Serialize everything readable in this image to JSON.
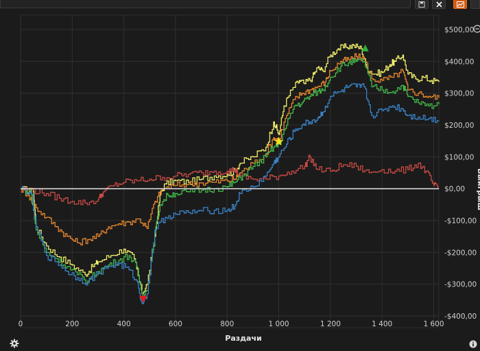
{
  "chart_data": {
    "type": "line",
    "title": "",
    "xlabel": "Раздачи",
    "ylabel": "Выигрыш",
    "xlim": [
      0,
      1620
    ],
    "ylim": [
      -400,
      500
    ],
    "x_ticks": [
      0,
      200,
      400,
      600,
      800,
      1000,
      1200,
      1400,
      1600
    ],
    "x_tick_labels": [
      "0",
      "200",
      "400",
      "600",
      "800",
      "1 000",
      "1 200",
      "1 400",
      "1 600"
    ],
    "y_ticks": [
      500,
      400,
      300,
      200,
      100,
      0,
      -100,
      -200,
      -300,
      -400
    ],
    "y_tick_labels": [
      "$500,00",
      "$400,00",
      "$300,00",
      "$200,00",
      "$100,00",
      "$0,00",
      "-$100,00",
      "-$200,00",
      "-$300,00",
      "-$400,00"
    ],
    "grid": true,
    "series": [
      {
        "color": "#f2ef6a",
        "points": [
          [
            0,
            0
          ],
          [
            50,
            -10
          ],
          [
            60,
            -120
          ],
          [
            100,
            -180
          ],
          [
            150,
            -215
          ],
          [
            200,
            -240
          ],
          [
            250,
            -270
          ],
          [
            280,
            -245
          ],
          [
            300,
            -230
          ],
          [
            350,
            -210
          ],
          [
            400,
            -190
          ],
          [
            440,
            -220
          ],
          [
            470,
            -330
          ],
          [
            490,
            -300
          ],
          [
            520,
            -150
          ],
          [
            540,
            -20
          ],
          [
            560,
            15
          ],
          [
            600,
            25
          ],
          [
            650,
            20
          ],
          [
            700,
            30
          ],
          [
            750,
            40
          ],
          [
            800,
            45
          ],
          [
            830,
            55
          ],
          [
            850,
            80
          ],
          [
            900,
            100
          ],
          [
            950,
            130
          ],
          [
            980,
            210
          ],
          [
            1000,
            170
          ],
          [
            1020,
            260
          ],
          [
            1050,
            310
          ],
          [
            1080,
            340
          ],
          [
            1100,
            330
          ],
          [
            1130,
            350
          ],
          [
            1150,
            380
          ],
          [
            1170,
            370
          ],
          [
            1200,
            420
          ],
          [
            1230,
            440
          ],
          [
            1260,
            445
          ],
          [
            1290,
            450
          ],
          [
            1320,
            440
          ],
          [
            1340,
            380
          ],
          [
            1370,
            360
          ],
          [
            1400,
            365
          ],
          [
            1430,
            390
          ],
          [
            1450,
            400
          ],
          [
            1480,
            420
          ],
          [
            1500,
            360
          ],
          [
            1530,
            345
          ],
          [
            1560,
            350
          ],
          [
            1590,
            340
          ],
          [
            1620,
            335
          ]
        ]
      },
      {
        "color": "#e7872e",
        "points": [
          [
            0,
            0
          ],
          [
            30,
            -20
          ],
          [
            60,
            -60
          ],
          [
            100,
            -90
          ],
          [
            140,
            -120
          ],
          [
            180,
            -150
          ],
          [
            220,
            -170
          ],
          [
            260,
            -160
          ],
          [
            300,
            -150
          ],
          [
            340,
            -120
          ],
          [
            380,
            -110
          ],
          [
            420,
            -105
          ],
          [
            460,
            -95
          ],
          [
            490,
            -125
          ],
          [
            520,
            -40
          ],
          [
            550,
            0
          ],
          [
            600,
            10
          ],
          [
            650,
            15
          ],
          [
            700,
            18
          ],
          [
            750,
            20
          ],
          [
            800,
            25
          ],
          [
            830,
            30
          ],
          [
            850,
            50
          ],
          [
            900,
            80
          ],
          [
            950,
            110
          ],
          [
            980,
            160
          ],
          [
            1000,
            155
          ],
          [
            1030,
            230
          ],
          [
            1060,
            280
          ],
          [
            1090,
            300
          ],
          [
            1120,
            310
          ],
          [
            1150,
            320
          ],
          [
            1180,
            335
          ],
          [
            1200,
            370
          ],
          [
            1240,
            400
          ],
          [
            1270,
            405
          ],
          [
            1300,
            415
          ],
          [
            1330,
            410
          ],
          [
            1360,
            345
          ],
          [
            1400,
            340
          ],
          [
            1440,
            350
          ],
          [
            1480,
            370
          ],
          [
            1500,
            310
          ],
          [
            1540,
            300
          ],
          [
            1580,
            290
          ],
          [
            1620,
            285
          ]
        ]
      },
      {
        "color": "#c94b45",
        "points": [
          [
            0,
            0
          ],
          [
            50,
            -5
          ],
          [
            100,
            -15
          ],
          [
            150,
            -30
          ],
          [
            200,
            -40
          ],
          [
            250,
            -45
          ],
          [
            300,
            -35
          ],
          [
            320,
            -10
          ],
          [
            360,
            10
          ],
          [
            400,
            20
          ],
          [
            450,
            25
          ],
          [
            500,
            30
          ],
          [
            550,
            35
          ],
          [
            600,
            40
          ],
          [
            650,
            45
          ],
          [
            700,
            50
          ],
          [
            750,
            55
          ],
          [
            800,
            55
          ],
          [
            830,
            60
          ],
          [
            850,
            40
          ],
          [
            900,
            30
          ],
          [
            950,
            30
          ],
          [
            1000,
            40
          ],
          [
            1050,
            55
          ],
          [
            1100,
            70
          ],
          [
            1120,
            100
          ],
          [
            1150,
            60
          ],
          [
            1200,
            55
          ],
          [
            1250,
            75
          ],
          [
            1300,
            70
          ],
          [
            1350,
            50
          ],
          [
            1400,
            60
          ],
          [
            1450,
            55
          ],
          [
            1500,
            60
          ],
          [
            1540,
            80
          ],
          [
            1570,
            55
          ],
          [
            1600,
            10
          ],
          [
            1620,
            0
          ]
        ]
      },
      {
        "color": "#44b94b",
        "points": [
          [
            0,
            0
          ],
          [
            40,
            -15
          ],
          [
            60,
            -130
          ],
          [
            100,
            -200
          ],
          [
            140,
            -220
          ],
          [
            180,
            -245
          ],
          [
            220,
            -270
          ],
          [
            260,
            -290
          ],
          [
            300,
            -260
          ],
          [
            340,
            -240
          ],
          [
            380,
            -225
          ],
          [
            420,
            -210
          ],
          [
            450,
            -245
          ],
          [
            470,
            -330
          ],
          [
            490,
            -320
          ],
          [
            520,
            -140
          ],
          [
            540,
            -50
          ],
          [
            570,
            -20
          ],
          [
            600,
            -15
          ],
          [
            650,
            -10
          ],
          [
            700,
            -5
          ],
          [
            750,
            0
          ],
          [
            800,
            5
          ],
          [
            830,
            20
          ],
          [
            860,
            40
          ],
          [
            900,
            70
          ],
          [
            950,
            100
          ],
          [
            980,
            130
          ],
          [
            1000,
            140
          ],
          [
            1030,
            200
          ],
          [
            1060,
            260
          ],
          [
            1090,
            270
          ],
          [
            1120,
            290
          ],
          [
            1150,
            305
          ],
          [
            1170,
            310
          ],
          [
            1200,
            350
          ],
          [
            1240,
            385
          ],
          [
            1270,
            395
          ],
          [
            1300,
            400
          ],
          [
            1330,
            400
          ],
          [
            1360,
            320
          ],
          [
            1400,
            310
          ],
          [
            1440,
            305
          ],
          [
            1480,
            325
          ],
          [
            1500,
            290
          ],
          [
            1540,
            270
          ],
          [
            1580,
            260
          ],
          [
            1620,
            265
          ]
        ]
      },
      {
        "color": "#3a84c9",
        "points": [
          [
            0,
            0
          ],
          [
            40,
            -10
          ],
          [
            60,
            -120
          ],
          [
            100,
            -210
          ],
          [
            140,
            -230
          ],
          [
            180,
            -260
          ],
          [
            220,
            -280
          ],
          [
            260,
            -295
          ],
          [
            300,
            -265
          ],
          [
            340,
            -245
          ],
          [
            380,
            -235
          ],
          [
            420,
            -255
          ],
          [
            450,
            -290
          ],
          [
            470,
            -360
          ],
          [
            490,
            -330
          ],
          [
            520,
            -130
          ],
          [
            560,
            -90
          ],
          [
            600,
            -80
          ],
          [
            650,
            -75
          ],
          [
            700,
            -70
          ],
          [
            750,
            -68
          ],
          [
            800,
            -68
          ],
          [
            830,
            -55
          ],
          [
            850,
            -15
          ],
          [
            900,
            5
          ],
          [
            950,
            40
          ],
          [
            980,
            80
          ],
          [
            1000,
            100
          ],
          [
            1030,
            140
          ],
          [
            1060,
            180
          ],
          [
            1090,
            200
          ],
          [
            1120,
            210
          ],
          [
            1150,
            220
          ],
          [
            1170,
            240
          ],
          [
            1200,
            290
          ],
          [
            1240,
            305
          ],
          [
            1270,
            320
          ],
          [
            1300,
            320
          ],
          [
            1330,
            320
          ],
          [
            1360,
            230
          ],
          [
            1400,
            245
          ],
          [
            1440,
            260
          ],
          [
            1480,
            250
          ],
          [
            1500,
            230
          ],
          [
            1540,
            225
          ],
          [
            1580,
            220
          ],
          [
            1620,
            215
          ]
        ]
      }
    ],
    "markers": [
      {
        "type": "triangle-up",
        "color": "#2bb13a",
        "x": 1335,
        "y": 440
      },
      {
        "type": "star",
        "color": "#f4e21a",
        "x": 1000,
        "y": 148
      },
      {
        "type": "triangle-down",
        "color": "#e01b1b",
        "x": 475,
        "y": -345
      }
    ],
    "zero_line_color": "#d8d8d8"
  },
  "icons": {
    "settings": "gear-icon",
    "info": "info-icon",
    "zoom": "zoom-out-icon",
    "save": "save-icon",
    "close": "close-icon",
    "chart": "chart-icon"
  }
}
